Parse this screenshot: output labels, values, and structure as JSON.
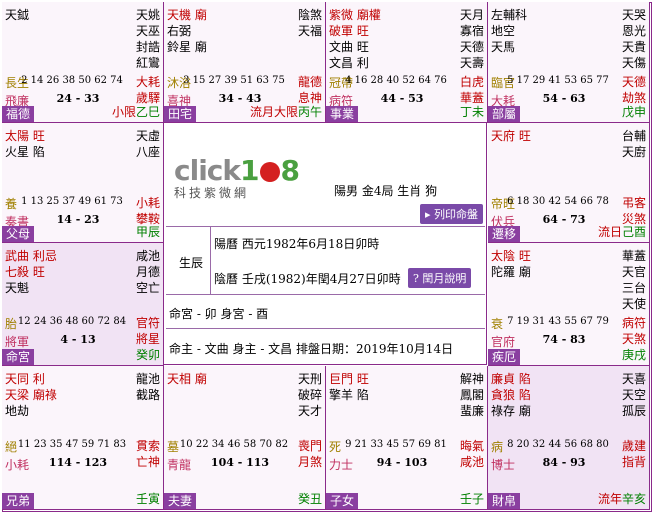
{
  "center": {
    "logo_text": "click",
    "logo_num": "1",
    "logo_num2": "8",
    "logo_sub": "科技紫微網",
    "gender_info": "陽男 金4局 生肖 狗",
    "print_button": "列印命盤",
    "birth_label": "生辰",
    "solar_date": "陽曆 西元1982年6月18日卯時",
    "lunar_date": "陰曆 壬戌(1982)年閏4月27日卯時",
    "leap_month_button": "閏月說明",
    "ming_shen": "命宮 - 卯  身宮 - 酉",
    "zhu_line": "命主 - 文曲  身主 - 文昌  排盤日期：2019年10月14日"
  },
  "palaces": {
    "si": {
      "stars_left": [
        "天鉞"
      ],
      "stars_right": [
        "天姚",
        "天巫",
        "封誥",
        "紅鸞"
      ],
      "stage": "長生",
      "numbers": "2 14 26 38 50 62 74",
      "star2": [
        "大耗",
        "歲驛"
      ],
      "minor_left": "飛廉",
      "age": "24 - 33",
      "palace": "福德",
      "ganzhi": "小限乙巳"
    },
    "wu": {
      "stars_left": [
        "天機 廟",
        "右弼",
        "鈴星 廟"
      ],
      "stars_right": [
        "陰煞",
        "天福"
      ],
      "stage": "沐浴",
      "numbers": "3 15 27 39 51 63 75",
      "star2": [
        "龍德",
        "息神"
      ],
      "minor_left": "喜神",
      "age": "34 - 43",
      "palace": "田宅",
      "ganzhi": "流月大限丙午"
    },
    "wei": {
      "stars_left": [
        "紫微 廟權",
        "破軍 旺",
        "文曲 旺",
        "文昌 利"
      ],
      "stars_right": [
        "天月",
        "寡宿",
        "天德",
        "天壽"
      ],
      "stage": "冠帶",
      "numbers": "4 16 28 40 52 64 76",
      "star2": [
        "白虎",
        "華蓋"
      ],
      "minor_left": "病符",
      "age": "44 - 53",
      "palace": "事業",
      "ganzhi": "丁未"
    },
    "shen": {
      "stars_left": [
        "左輔科",
        "地空",
        "天馬"
      ],
      "stars_right": [
        "天哭",
        "恩光",
        "天貴",
        "天傷"
      ],
      "stage": "臨官",
      "numbers": "5 17 29 41 53 65 77",
      "star2": [
        "天德",
        "劫煞"
      ],
      "minor_left": "大耗",
      "age": "54 - 63",
      "palace": "部屬",
      "ganzhi": "戊申"
    },
    "chen": {
      "stars_left": [
        "太陽 旺",
        "火星 陷"
      ],
      "stars_right": [
        "天虛",
        "八座"
      ],
      "stage": "養",
      "numbers": "1 13 25 37 49 61 73",
      "star2": [
        "小耗",
        "攀鞍"
      ],
      "minor_left": "奏書",
      "age": "14 - 23",
      "palace": "父母",
      "ganzhi": "甲辰"
    },
    "you": {
      "stars_left": [
        "天府 旺"
      ],
      "stars_right": [
        "台輔",
        "天廚"
      ],
      "stage": "帝旺",
      "numbers": "6 18 30 42 54 66 78",
      "star2": [
        "弔客",
        "災煞"
      ],
      "minor_left": "伏兵",
      "age": "64 - 73",
      "palace": "遷移",
      "ganzhi": "流日己酉"
    },
    "mao": {
      "stars_left": [
        "武曲 利忌",
        "七殺 旺",
        "天魁"
      ],
      "stars_right": [
        "咸池",
        "月德",
        "空亡"
      ],
      "stage": "胎",
      "numbers": "12 24 36 48 60 72 84",
      "star2": [
        "官符",
        "將星"
      ],
      "minor_left": "將軍",
      "age": "4 - 13",
      "palace": "命宮",
      "ganzhi": "癸卯"
    },
    "xu": {
      "stars_left": [
        "太陰 旺",
        "陀羅 廟"
      ],
      "stars_right": [
        "華蓋",
        "天官",
        "三台",
        "天使"
      ],
      "stage": "衰",
      "numbers": "7 19 31 43 55 67 79",
      "star2": [
        "病符",
        "天煞"
      ],
      "minor_left": "官府",
      "age": "74 - 83",
      "palace": "疾厄",
      "ganzhi": "庚戌"
    },
    "yin": {
      "stars_left": [
        "天同 利",
        "天梁 廟祿",
        "地劫"
      ],
      "stars_right": [
        "龍池",
        "截路"
      ],
      "stage": "絕",
      "numbers": "11 23 35 47 59 71 83",
      "star2": [
        "貫索",
        "亡神"
      ],
      "minor_left": "小耗",
      "age": "114 - 123",
      "palace": "兄弟",
      "ganzhi": "壬寅"
    },
    "chou": {
      "stars_left": [
        "天相 廟"
      ],
      "stars_right": [
        "天刑",
        "破碎",
        "天才"
      ],
      "stage": "墓",
      "numbers": "10 22 34 46 58 70 82",
      "star2": [
        "喪門",
        "月煞"
      ],
      "minor_left": "青龍",
      "age": "104 - 113",
      "palace": "夫妻",
      "ganzhi": "癸丑"
    },
    "zi": {
      "stars_left": [
        "巨門 旺",
        "擎羊 陷"
      ],
      "stars_right": [
        "解神",
        "鳳閣",
        "蜚廉"
      ],
      "stage": "死",
      "numbers": "9 21 33 45 57 69 81",
      "star2": [
        "晦氣",
        "咸池"
      ],
      "minor_left": "力士",
      "age": "94 - 103",
      "palace": "子女",
      "ganzhi": "壬子"
    },
    "hai": {
      "stars_left": [
        "廉貞 陷",
        "貪狼 陷",
        "祿存 廟"
      ],
      "stars_right": [
        "天喜",
        "天空",
        "孤辰"
      ],
      "stage": "病",
      "numbers": "8 20 32 44 56 68 80",
      "star2": [
        "歲建",
        "指背"
      ],
      "minor_left": "博士",
      "age": "84 - 93",
      "palace": "財帛",
      "ganzhi": "流年辛亥"
    }
  }
}
